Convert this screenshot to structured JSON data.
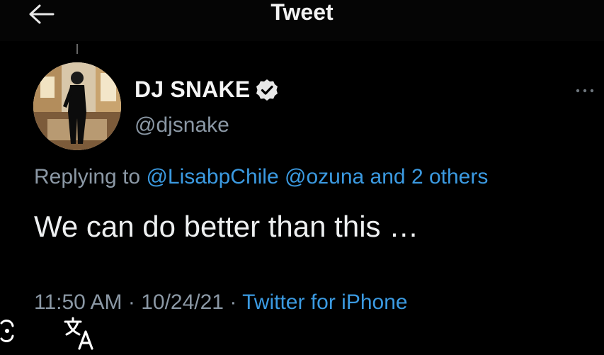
{
  "header": {
    "title": "Tweet"
  },
  "tweet": {
    "author_name": "DJ SNAKE",
    "handle": "@djsnake",
    "verified": true,
    "replying_prefix": "Replying to",
    "replying_handles": "@LisabpChile @ozuna",
    "replying_and": "and",
    "replying_others": "2 others",
    "text": "We can do better than this …",
    "time": "11:50 AM",
    "date": "10/24/21",
    "separator": "·",
    "source": "Twitter for iPhone"
  },
  "icons": {
    "back": "arrow-left-icon",
    "verified": "verified-badge-icon",
    "more": "more-horizontal-icon",
    "translate": "translate-icon"
  },
  "colors": {
    "background": "#000000",
    "link": "#3b9ae1",
    "secondary_text": "#8b98a5",
    "primary_text": "#e7e9ea"
  }
}
